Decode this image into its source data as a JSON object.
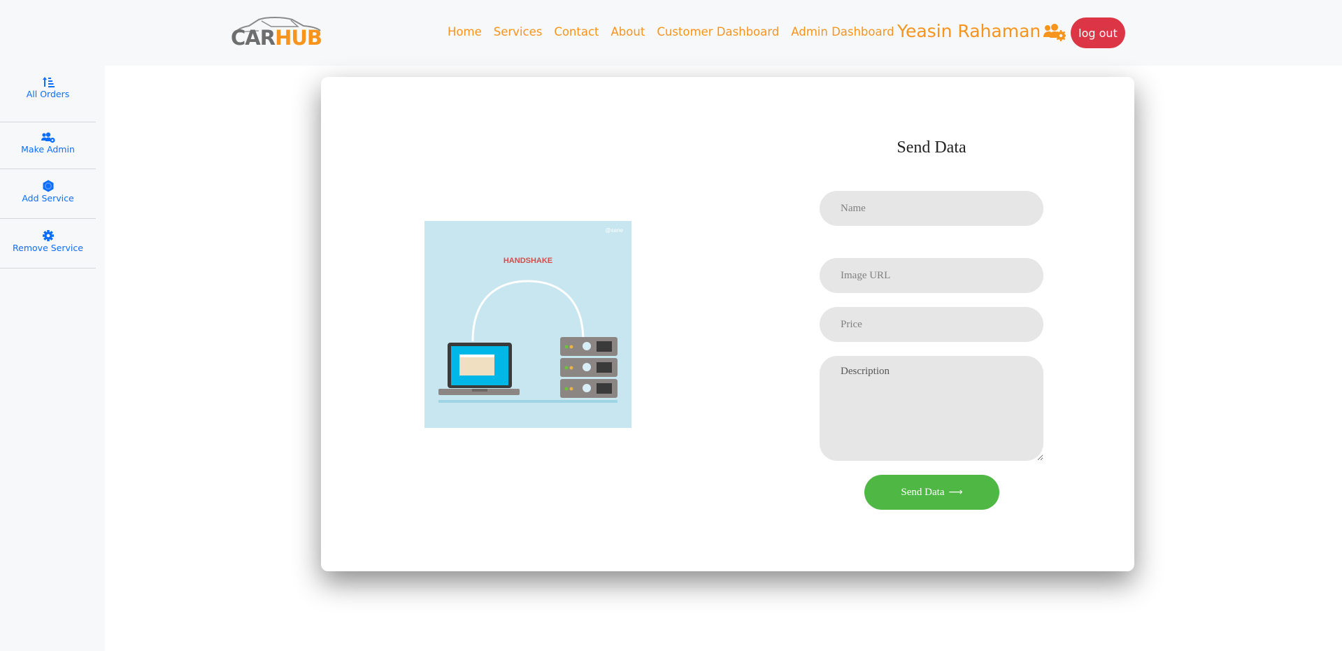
{
  "brand": {
    "logo_part1": "CAR",
    "logo_part2": "HUB"
  },
  "nav": {
    "items": [
      {
        "label": "Home"
      },
      {
        "label": "Services"
      },
      {
        "label": "Contact"
      },
      {
        "label": "About"
      },
      {
        "label": "Customer Dashboard"
      },
      {
        "label": "Admin Dashboard"
      }
    ],
    "user_name": "Yeasin Rahaman",
    "user_icon": "users-cog-icon",
    "logout_label": "log out"
  },
  "sidebar": {
    "items": [
      {
        "label": "All Orders",
        "icon": "sort-amount-up-icon"
      },
      {
        "label": "Make Admin",
        "icon": "users-cog-icon"
      },
      {
        "label": "Add Service",
        "icon": "hexagon-icon"
      },
      {
        "label": "Remove Service",
        "icon": "cog-icon"
      }
    ]
  },
  "form": {
    "title": "Send Data",
    "name_placeholder": "Name",
    "image_url_placeholder": "Image URL",
    "price_placeholder": "Price",
    "description_placeholder": "Description",
    "submit_label": "Send Data",
    "submit_icon": "long-arrow-right-icon"
  },
  "illustration": {
    "caption": "HANDSHAKE",
    "watermark": "@sane"
  },
  "colors": {
    "accent": "#f7941d",
    "logout": "#dc3545",
    "submit": "#4fb845",
    "sidebar_link": "#0d6efd",
    "input_bg": "#e6e6e6"
  }
}
